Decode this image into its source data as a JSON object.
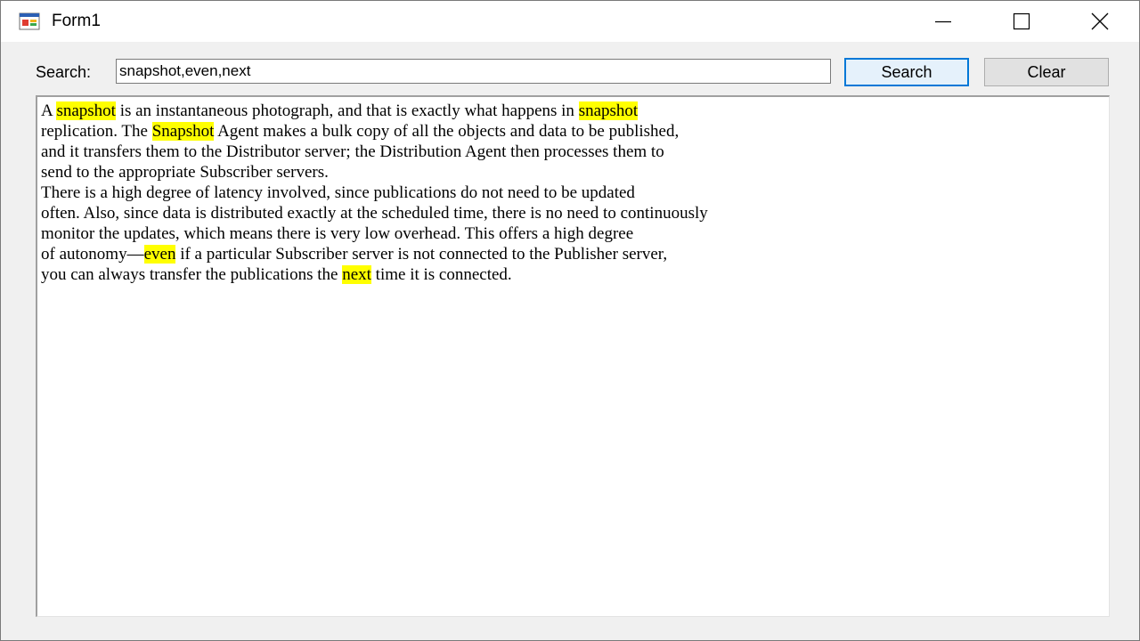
{
  "window": {
    "title": "Form1",
    "controls": {
      "minimize": "minimize-icon",
      "maximize": "maximize-icon",
      "close": "close-icon"
    }
  },
  "search": {
    "label": "Search:",
    "value": "snapshot,even,next",
    "search_button": "Search",
    "clear_button": "Clear"
  },
  "colors": {
    "highlight": "#ffff00",
    "focus_border": "#0078d7"
  },
  "text_lines": [
    [
      {
        "t": "A "
      },
      {
        "t": "snapshot",
        "hl": true
      },
      {
        "t": " is an instantaneous photograph, and that is exactly what happens in "
      },
      {
        "t": "snapshot",
        "hl": true
      }
    ],
    [
      {
        "t": "replication. The "
      },
      {
        "t": "Snapshot",
        "hl": true
      },
      {
        "t": " Agent makes a bulk copy of all the objects and data to be published,"
      }
    ],
    [
      {
        "t": "and it transfers them to the Distributor server; the Distribution Agent then processes them to"
      }
    ],
    [
      {
        "t": "send to the appropriate Subscriber servers."
      }
    ],
    [
      {
        "t": "There is a high degree of latency involved, since publications do not need to be updated"
      }
    ],
    [
      {
        "t": "often. Also, since data is distributed exactly at the scheduled time, there is no need to continuously"
      }
    ],
    [
      {
        "t": "monitor the updates, which means there is very low overhead. This offers a high degree"
      }
    ],
    [
      {
        "t": "of autonomy—"
      },
      {
        "t": "even",
        "hl": true
      },
      {
        "t": " if a particular Subscriber server is not connected to the Publisher server,"
      }
    ],
    [
      {
        "t": "you can always transfer the publications the "
      },
      {
        "t": "next",
        "hl": true
      },
      {
        "t": " time it is connected."
      }
    ]
  ]
}
